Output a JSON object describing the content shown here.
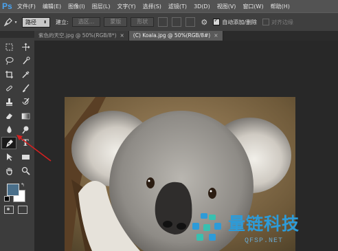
{
  "app": {
    "logo": "Ps"
  },
  "menu": [
    "文件(F)",
    "编辑(E)",
    "图像(I)",
    "图层(L)",
    "文字(Y)",
    "选择(S)",
    "滤镜(T)",
    "3D(D)",
    "视图(V)",
    "窗口(W)",
    "帮助(H)"
  ],
  "options": {
    "mode_value": "路径",
    "make_label": "建立:",
    "selection_button": "选区...",
    "mask_button": "蒙版",
    "shape_button": "形状",
    "auto_add_delete": "自动添加/删除",
    "auto_add_delete_checked": true,
    "align_edges": "对齐边缘",
    "align_edges_checked": false
  },
  "tabs": [
    {
      "label": "紫色的天空.jpg @ 50%(RGB/8*)",
      "active": false,
      "close": "×"
    },
    {
      "label": "(C) Koala.jpg @ 50%(RGB/8#)",
      "active": true,
      "close": "×"
    }
  ],
  "tools": {
    "text_tool_glyph": "T",
    "colors": {
      "foreground": "#4a6f8a",
      "background": "#ffffff"
    }
  },
  "watermark": {
    "text": "量链科技",
    "url": "QFSP.NET",
    "color": "#2d9bd8"
  }
}
